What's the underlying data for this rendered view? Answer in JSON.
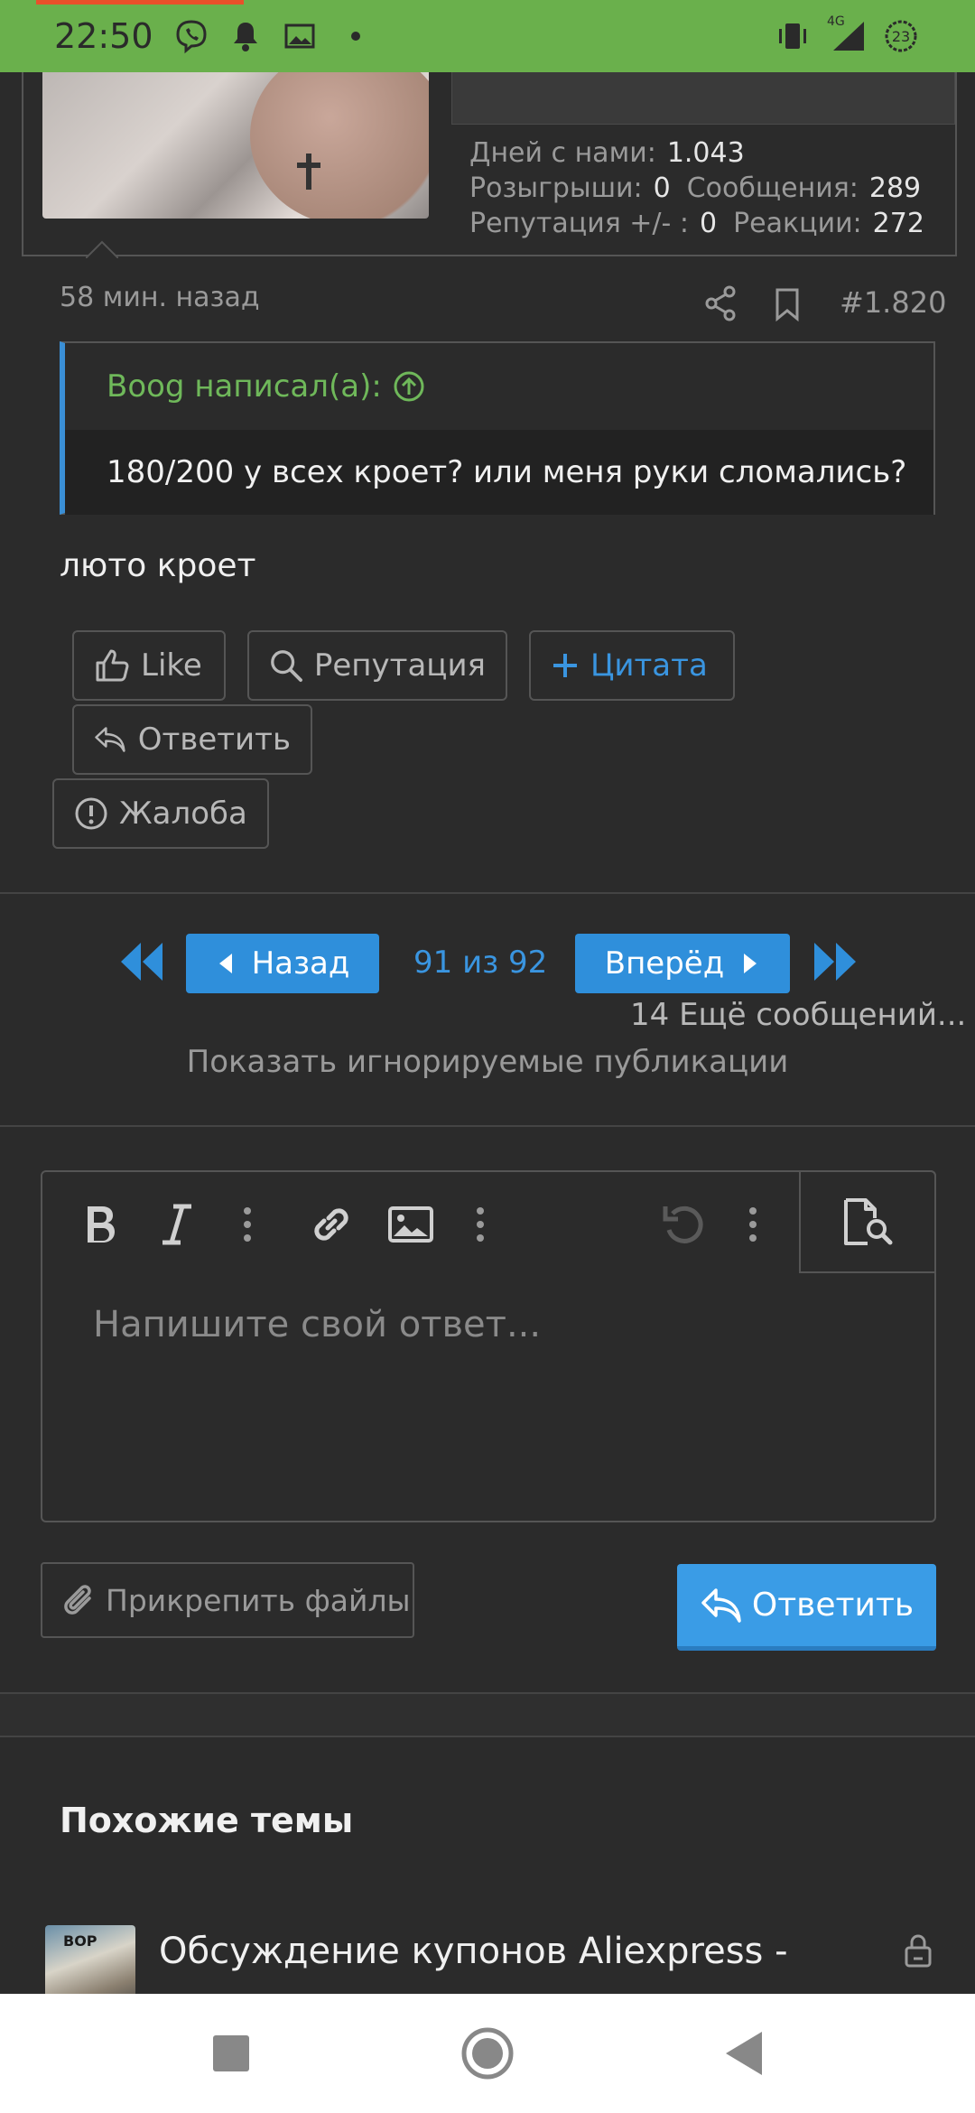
{
  "status_bar": {
    "time": "22:50",
    "network": "4G",
    "battery": "23"
  },
  "profile": {
    "stats": [
      [
        {
          "label": "Дней с нами:",
          "value": "1.043"
        }
      ],
      [
        {
          "label": "Розыгрыши:",
          "value": "0"
        },
        {
          "label": "Сообщения:",
          "value": "289"
        }
      ],
      [
        {
          "label": "Репутация +/- :",
          "value": "0"
        },
        {
          "label": "Реакции:",
          "value": "272"
        }
      ]
    ]
  },
  "post": {
    "time_ago": "58 мин. назад",
    "post_number": "#1.820",
    "quote_author": "Boog написал(а):",
    "quote_text": "180/200 у всех кроет? или меня руки сломались?",
    "message": "люто кроет"
  },
  "actions": {
    "like": "Like",
    "reputation": "Репутация",
    "quote": "Цитата",
    "reply": "Ответить",
    "report": "Жалоба"
  },
  "pagination": {
    "prev": "Назад",
    "info": "91 из 92",
    "next": "Вперёд",
    "more_messages": "14 Ещё сообщений...",
    "show_ignored": "Показать игнорируемые публикации"
  },
  "editor": {
    "placeholder": "Напишите свой ответ...",
    "attach_label": "Прикрепить файлы",
    "reply_label": "Ответить"
  },
  "similar": {
    "title": "Похожие темы",
    "threads": [
      {
        "title": "Обсуждение купонов Aliexpress -",
        "thumb_text": "ВОР"
      }
    ]
  },
  "colors": {
    "status_bar": "#6ab04c",
    "accent_blue": "#2f8fdb",
    "quote_green": "#6fb85a",
    "background": "#2b2b2b"
  }
}
